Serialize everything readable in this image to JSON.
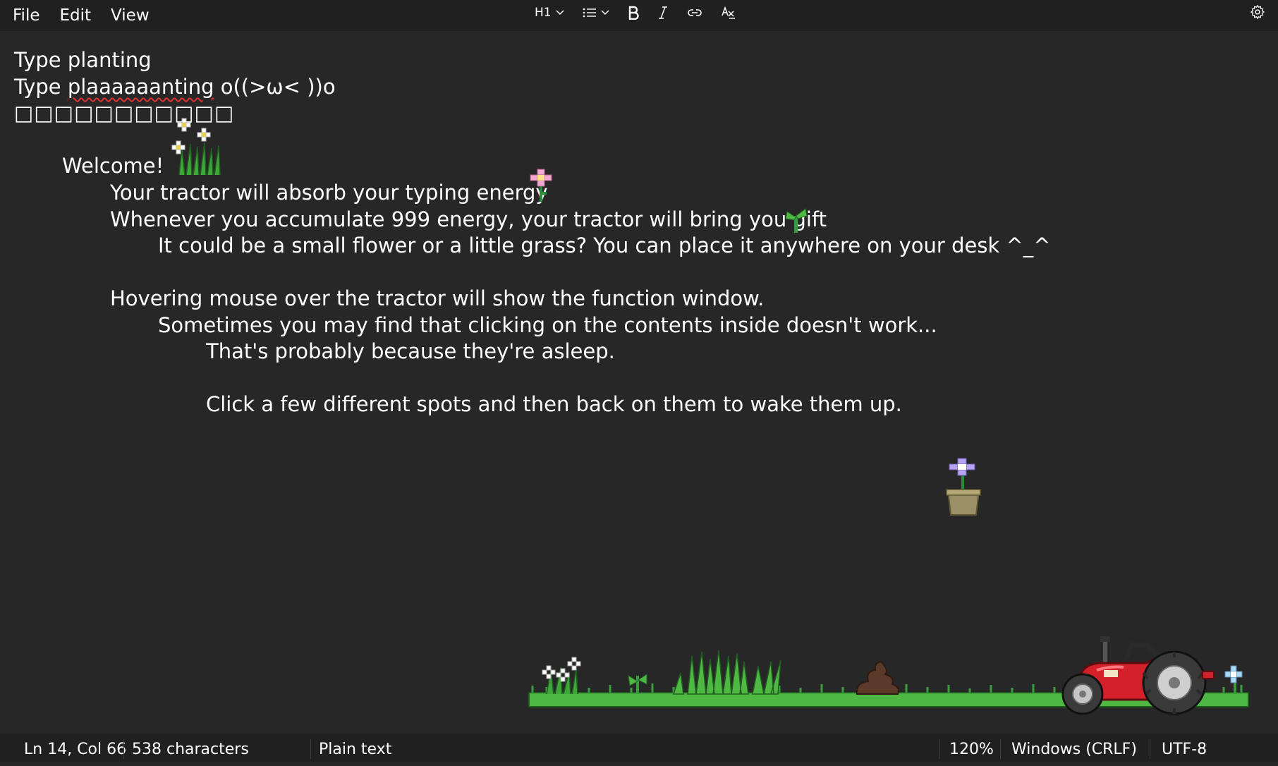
{
  "menu": {
    "file": "File",
    "edit": "Edit",
    "view": "View"
  },
  "toolbar": {
    "heading": "H1",
    "heading_icon": "chevron-down-icon",
    "list_icon": "bulleted-list-icon",
    "bold_icon": "bold-icon",
    "italic_icon": "italic-icon",
    "link_icon": "link-icon",
    "clear_format_icon": "clear-formatting-icon",
    "settings_icon": "gear-icon"
  },
  "document": {
    "lines": [
      "Type planting",
      "Type ",
      "plaaaaaanting",
      " o((>ω< ))o",
      "□□□□□□□□□□□",
      "Welcome!",
      "Your tractor will absorb your typing energy",
      "Whenever you accumulate 999 energy, your tractor will bring you gift",
      "It could be a small flower or a little grass? You can place it anywhere on your desk ^_^",
      "Hovering mouse over the tractor will show the function window.",
      "Sometimes you may find that clicking on the contents inside doesn't work...",
      "That's probably because they're asleep.",
      "Click a few different spots and then back on them to wake them up."
    ]
  },
  "status": {
    "position": "Ln 14, Col 66",
    "characters": "538 characters",
    "format": "Plain text",
    "zoom": "120%",
    "line_ending": "Windows (CRLF)",
    "encoding": "UTF-8"
  },
  "colors": {
    "background": "#272727",
    "bar": "#202020",
    "tractor_red": "#d4202a",
    "grass": "#4fb842",
    "spellcheck": "#e03232"
  }
}
